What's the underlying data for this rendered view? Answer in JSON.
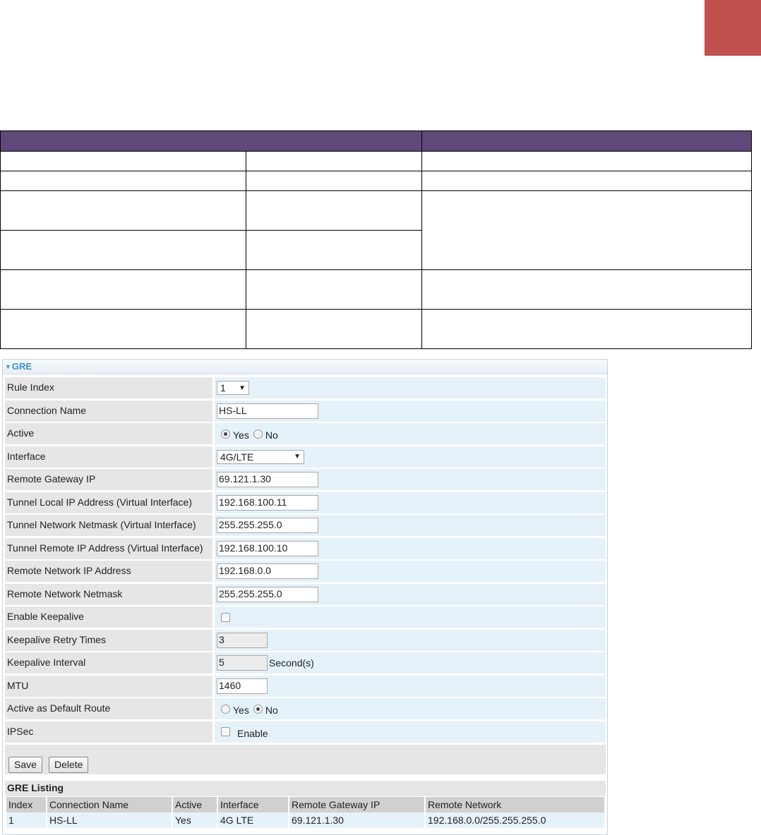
{
  "gre": {
    "title": "GRE",
    "fields": {
      "rule_index": {
        "label": "Rule Index",
        "value": "1"
      },
      "connection_name": {
        "label": "Connection Name",
        "value": "HS-LL"
      },
      "active": {
        "label": "Active",
        "options": [
          "Yes",
          "No"
        ],
        "selected": "Yes"
      },
      "interface": {
        "label": "Interface",
        "value": "4G/LTE"
      },
      "remote_gateway_ip": {
        "label": "Remote Gateway IP",
        "value": "69.121.1.30"
      },
      "tunnel_local_ip": {
        "label": "Tunnel Local IP Address (Virtual Interface)",
        "value": "192.168.100.11"
      },
      "tunnel_netmask": {
        "label": "Tunnel Network Netmask (Virtual Interface)",
        "value": "255.255.255.0"
      },
      "tunnel_remote_ip": {
        "label": "Tunnel Remote IP Address (Virtual Interface)",
        "value": "192.168.100.10"
      },
      "remote_network_ip": {
        "label": "Remote Network IP Address",
        "value": "192.168.0.0"
      },
      "remote_network_netmask": {
        "label": "Remote Network Netmask",
        "value": "255.255.255.0"
      },
      "enable_keepalive": {
        "label": "Enable Keepalive",
        "checked": false
      },
      "keepalive_retry": {
        "label": "Keepalive Retry Times",
        "value": "3"
      },
      "keepalive_interval": {
        "label": "Keepalive Interval",
        "value": "5",
        "unit": "Second(s)"
      },
      "mtu": {
        "label": "MTU",
        "value": "1460"
      },
      "default_route": {
        "label": "Active as Default Route",
        "options": [
          "Yes",
          "No"
        ],
        "selected": "No"
      },
      "ipsec": {
        "label": "IPSec",
        "checkbox_label": "Enable",
        "checked": false
      }
    },
    "buttons": {
      "save": "Save",
      "delete": "Delete"
    },
    "listing": {
      "title": "GRE Listing",
      "columns": [
        "Index",
        "Connection Name",
        "Active",
        "Interface",
        "Remote Gateway IP",
        "Remote Network"
      ],
      "rows": [
        [
          "1",
          "HS-LL",
          "Yes",
          "4G LTE",
          "69.121.1.30",
          "192.168.0.0/255.255.255.0"
        ]
      ]
    }
  },
  "colors": {
    "corner_block": "#c0504d",
    "doc_table_header": "#5f497a",
    "panel_title": "#3a8fd0"
  }
}
